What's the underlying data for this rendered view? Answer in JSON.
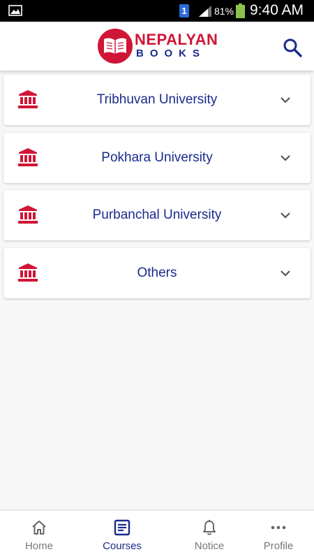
{
  "status_bar": {
    "sim_slot": "1",
    "battery_percent": "81%",
    "time": "9:40 AM"
  },
  "header": {
    "logo_top": "NEPALYAN",
    "logo_bottom": "BOOKS"
  },
  "colors": {
    "brand_red": "#d01536",
    "brand_navy": "#1a2a8c"
  },
  "universities": [
    {
      "label": "Tribhuvan University",
      "icon": "institution-icon"
    },
    {
      "label": "Pokhara University",
      "icon": "institution-icon"
    },
    {
      "label": "Purbanchal University",
      "icon": "institution-icon"
    },
    {
      "label": "Others",
      "icon": "institution-icon"
    }
  ],
  "bottom_nav": {
    "items": [
      {
        "label": "Home",
        "icon": "home-icon"
      },
      {
        "label": "Courses",
        "icon": "courses-icon",
        "active": true
      },
      {
        "label": "Notice",
        "icon": "bell-icon"
      },
      {
        "label": "Profile",
        "icon": "more-dots-icon"
      }
    ]
  }
}
